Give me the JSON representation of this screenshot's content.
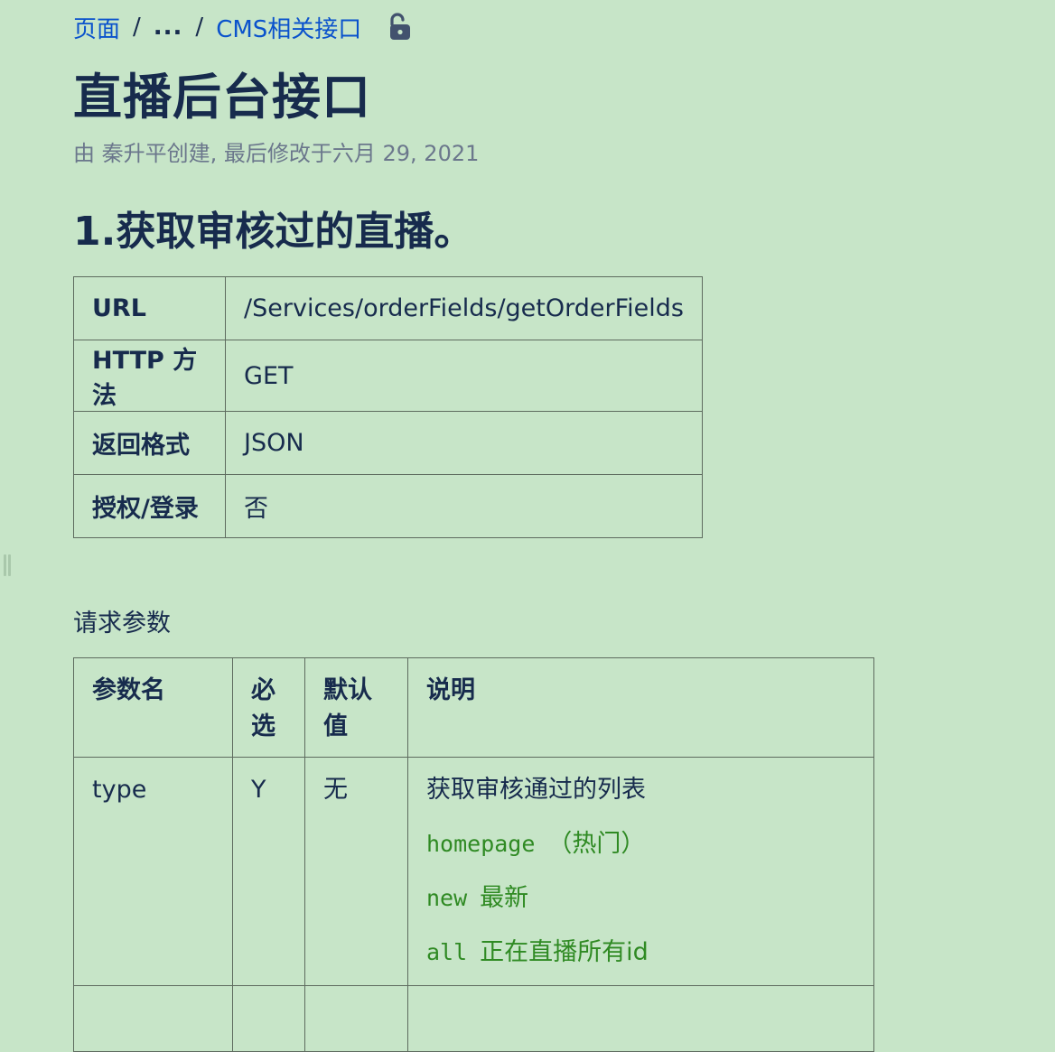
{
  "breadcrumb": {
    "root": "页面",
    "ellipsis": "...",
    "parent": "CMS相关接口",
    "lock_icon": "unlock-icon"
  },
  "page": {
    "title": "直播后台接口",
    "meta": "由 秦升平创建, 最后修改于六月 29, 2021"
  },
  "section": {
    "heading": "1.获取审核过的直播。"
  },
  "info_table": {
    "rows": [
      {
        "key": "URL",
        "value": "/Services/orderFields/getOrderFields"
      },
      {
        "key": "HTTP 方法",
        "value": "GET"
      },
      {
        "key": "返回格式",
        "value": "JSON"
      },
      {
        "key": "授权/登录",
        "value": "否"
      }
    ]
  },
  "request_params": {
    "label": "请求参数",
    "headers": {
      "name": "参数名",
      "required_line1": "必",
      "required_line2": "选",
      "default_line1": "默认",
      "default_line2": "值",
      "description": "说明"
    },
    "rows": [
      {
        "name": "type",
        "required": "Y",
        "default": "无",
        "description": "获取审核通过的列表",
        "options": [
          {
            "code": "homepage",
            "text": "（热门）"
          },
          {
            "code": "new",
            "text": "最新"
          },
          {
            "code": "all",
            "text": "正在直播所有id"
          }
        ]
      }
    ]
  },
  "colors": {
    "background": "#c7e5c8",
    "link": "#0a52cc",
    "text": "#172b4d",
    "meta": "#6b778c",
    "code": "#2f8a23",
    "border": "#5e6b5f"
  }
}
